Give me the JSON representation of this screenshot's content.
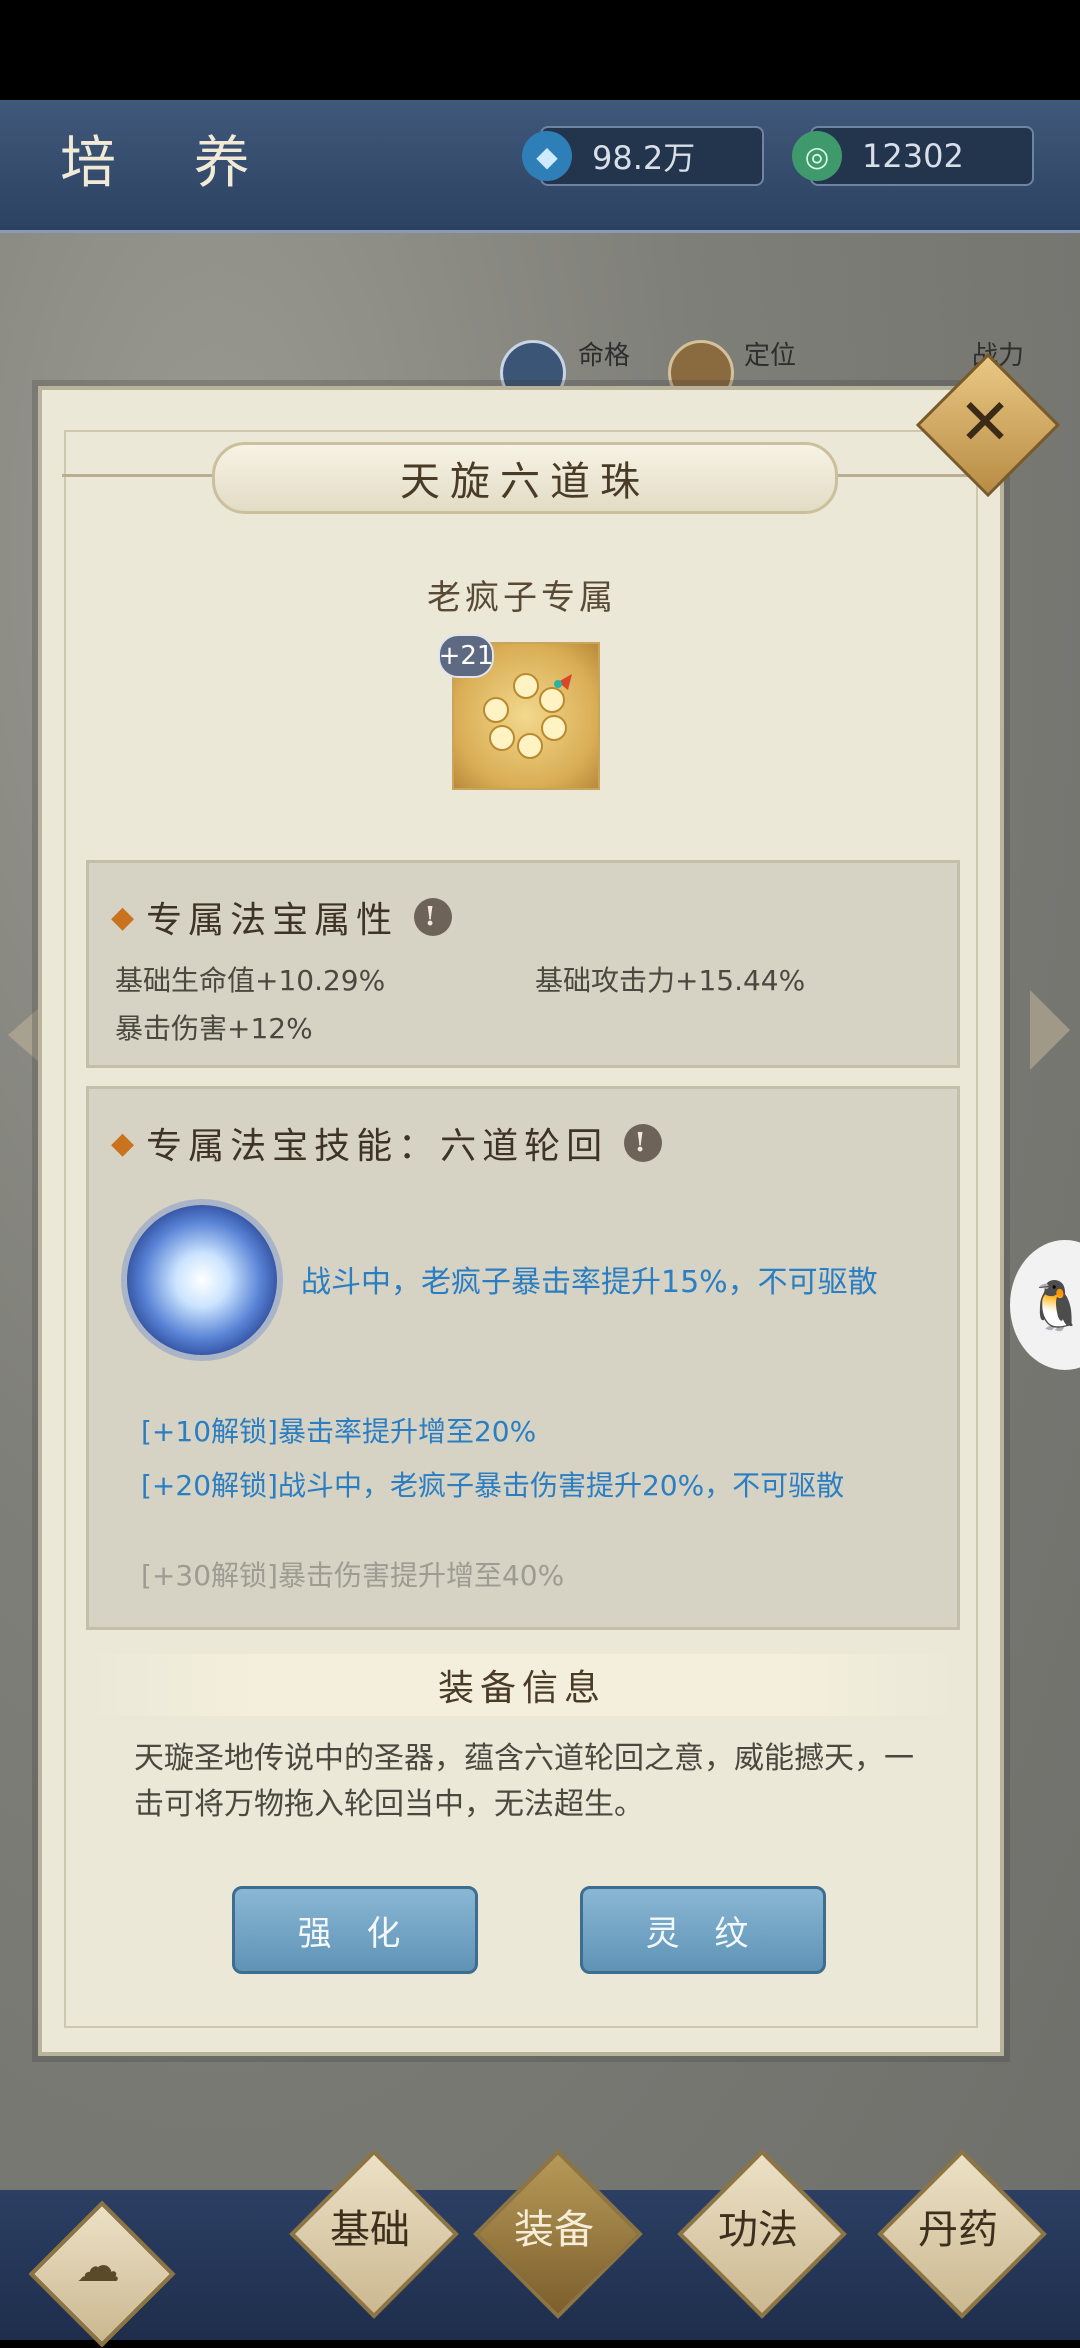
{
  "header": {
    "title": "培 养",
    "currency": [
      {
        "icon": "crystal-icon",
        "value": "98.2万"
      },
      {
        "icon": "jade-icon",
        "value": "12302"
      }
    ]
  },
  "hero_info": {
    "fate_label": "命格",
    "role_label": "定位",
    "power_label": "战力"
  },
  "dialog": {
    "title": "天旋六道珠",
    "exclusive": "老疯子专属",
    "item_level": "+21",
    "attributes": {
      "title": "专属法宝属性",
      "hp": "基础生命值+10.29%",
      "atk": "基础攻击力+15.44%",
      "crit_dmg": "暴击伤害+12%"
    },
    "skill": {
      "title": "专属法宝技能：六道轮回",
      "description": "战斗中，老疯子暴击率提升15%，不可驱散",
      "unlocks": [
        {
          "text": "[+10解锁]暴击率提升增至20%",
          "locked": false
        },
        {
          "text": "[+20解锁]战斗中，老疯子暴击伤害提升20%，不可驱散",
          "locked": false
        },
        {
          "text": "[+30解锁]暴击伤害提升增至40%",
          "locked": true
        }
      ]
    },
    "info": {
      "title": "装备信息",
      "text": "天璇圣地传说中的圣器，蕴含六道轮回之意，威能撼天，一击可将万物拖入轮回当中，无法超生。"
    },
    "buttons": {
      "enhance": "强 化",
      "rune": "灵 纹"
    }
  },
  "bottom_nav": {
    "tabs": [
      {
        "label": "基础",
        "active": false
      },
      {
        "label": "装备",
        "active": true
      },
      {
        "label": "功法",
        "active": false
      },
      {
        "label": "丹药",
        "active": false
      }
    ]
  }
}
